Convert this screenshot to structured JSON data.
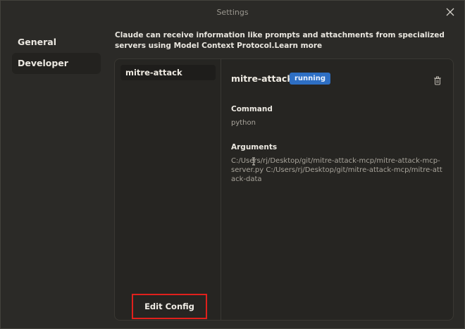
{
  "window": {
    "title": "Settings"
  },
  "nav": {
    "items": [
      {
        "label": "General"
      },
      {
        "label": "Developer"
      }
    ]
  },
  "intro": {
    "text": "Claude can receive information like prompts and attachments from specialized servers using Model Context Protocol.",
    "link": "Learn more"
  },
  "servers": [
    {
      "name": "mitre-attack"
    }
  ],
  "edit_config_label": "Edit Config",
  "detail": {
    "name": "mitre-attack",
    "status": "running",
    "command_label": "Command",
    "command_value": "python",
    "arguments_label": "Arguments",
    "arguments_value": "C:/Users/rj/Desktop/git/mitre-attack-mcp/mitre-attack-mcp-server.py C:/Users/rj/Desktop/git/mitre-attack-mcp/mitre-attack-data"
  },
  "colors": {
    "status_badge": "#2e6fc4",
    "highlight_box": "#e0201c",
    "background": "#2b2a27"
  }
}
